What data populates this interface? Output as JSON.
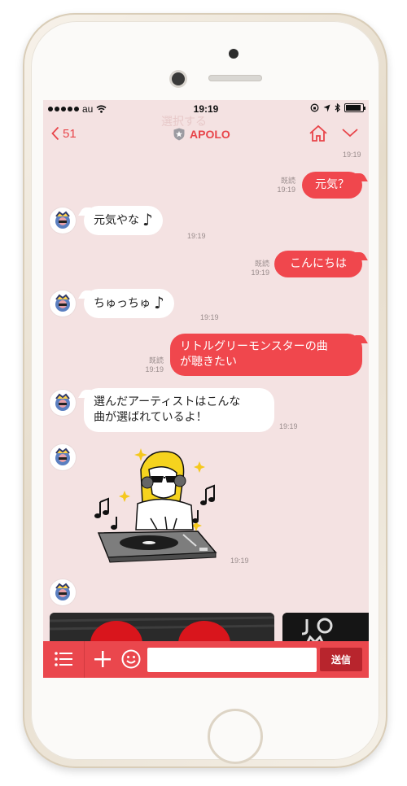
{
  "status_bar": {
    "carrier": "au",
    "time": "19:19"
  },
  "nav": {
    "ghost_title": "選択する",
    "back_count": "51",
    "title": "APOLO",
    "top_time": "19:19"
  },
  "messages": [
    {
      "side": "out",
      "text": "元気？",
      "read": "既読",
      "time": "19:19"
    },
    {
      "side": "in",
      "text": "元気やな",
      "note": "♪",
      "time": "19:19"
    },
    {
      "side": "out",
      "text": "こんにちは",
      "read": "既読",
      "time": "19:19"
    },
    {
      "side": "in",
      "text": "ちゅっちゅ",
      "note": "♪",
      "time": "19:19"
    },
    {
      "side": "out",
      "text_line1": "リトルグリーモンスターの曲",
      "text_line2": "が聴きたい",
      "read": "既読",
      "time": "19:19"
    },
    {
      "side": "in",
      "text_line1": "選んだアーティストはこんな",
      "text_line2": "曲が選ばれているよ！",
      "time": "19:19"
    },
    {
      "side": "in",
      "type": "sticker",
      "time": "19:19"
    }
  ],
  "toolbar": {
    "input_placeholder": "",
    "send_label": "送信"
  },
  "colors": {
    "accent": "#ea474d",
    "background": "#f4e2e2",
    "send_button": "#b8252d"
  },
  "icons": [
    "menu-icon",
    "plus-icon",
    "emoji-icon",
    "home-icon",
    "chevron-down-icon",
    "back-chevron-icon",
    "badge-icon"
  ]
}
